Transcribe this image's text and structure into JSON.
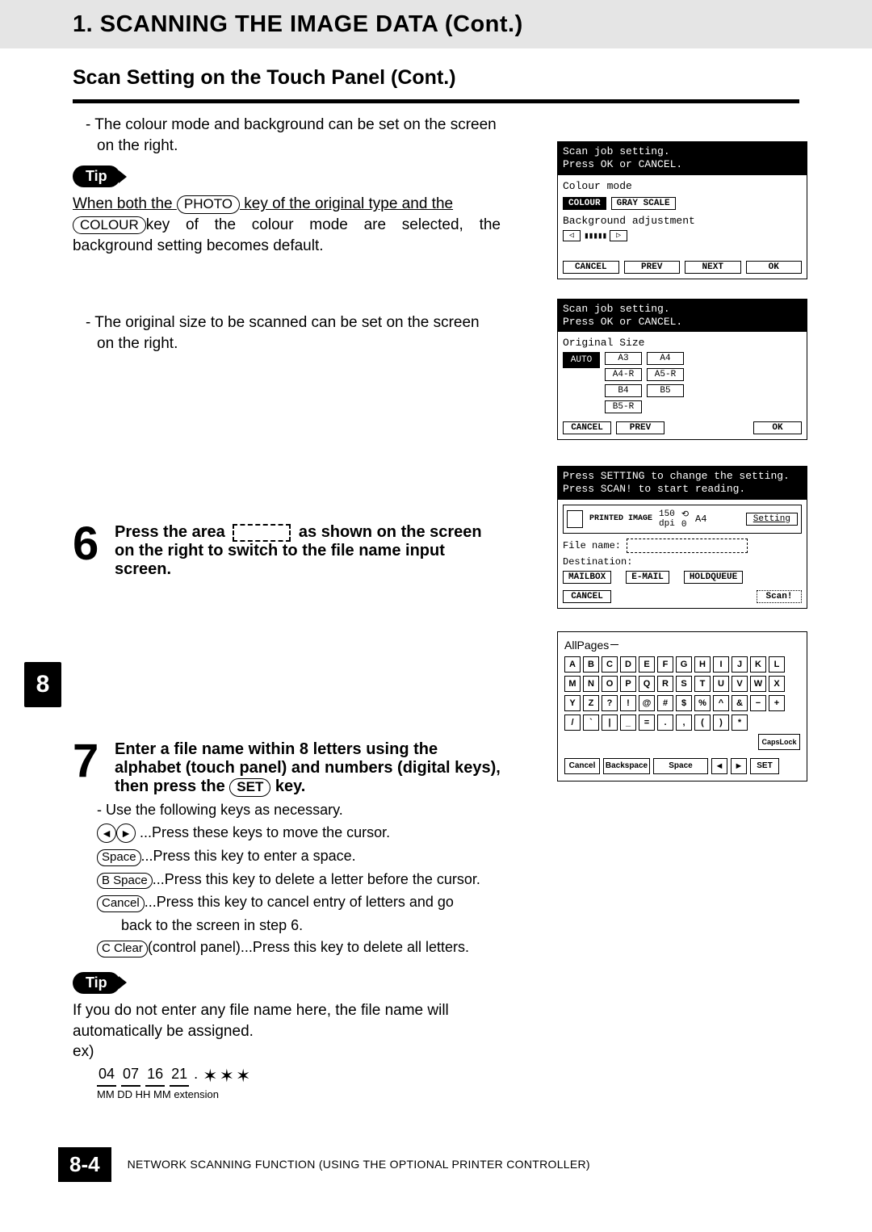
{
  "header": {
    "chapter": "1. SCANNING THE IMAGE DATA (Cont.)",
    "subsection": "Scan Setting on the Touch Panel (Cont.)"
  },
  "intro": {
    "p1": "The colour mode and background can be set on the screen on the right.",
    "tip_label": "Tip",
    "tip_body_1": "When both the ",
    "tip_key_photo": "PHOTO",
    "tip_body_2": " key of the original type and the ",
    "tip_key_colour": "COLOUR",
    "tip_body_3": "key of the colour mode are selected, the background setting becomes default.",
    "p2": "The original size to be scanned can be set on the screen on the right."
  },
  "screen1": {
    "head1": "Scan job setting.",
    "head2": "Press OK or CANCEL.",
    "colour_mode": "Colour mode",
    "btn_colour": "COLOUR",
    "btn_gray": "GRAY SCALE",
    "bg_adj": "Background adjustment",
    "cancel": "CANCEL",
    "prev": "PREV",
    "next": "NEXT",
    "ok": "OK"
  },
  "screen2": {
    "head1": "Scan job setting.",
    "head2": "Press OK or CANCEL.",
    "orig_size": "Original Size",
    "auto": "AUTO",
    "a3": "A3",
    "a4": "A4",
    "a4r": "A4-R",
    "a5r": "A5-R",
    "b4": "B4",
    "b5": "B5",
    "b5r": "B5-R",
    "cancel": "CANCEL",
    "prev": "PREV",
    "ok": "OK"
  },
  "step6": {
    "num": "6",
    "text_a": "Press the area ",
    "text_b": " as shown on the screen on the right to switch to the file name input screen."
  },
  "screen3": {
    "head1": "Press SETTING to change the setting.",
    "head2": "Press SCAN! to start reading.",
    "printed_image": "PRINTED IMAGE",
    "dpi_val": "150",
    "dpi_label": "dpi",
    "orient_val": "0",
    "size_val": "A4",
    "setting": "Setting",
    "file_name": "File name:",
    "destination": "Destination:",
    "mailbox": "MAILBOX",
    "email": "E-MAIL",
    "holdqueue": "HOLDQUEUE",
    "cancel": "CANCEL",
    "scan": "Scan!"
  },
  "step7": {
    "num": "7",
    "line1": "Enter a file name within 8 letters using the alphabet (touch panel) and numbers (digital keys), then press the ",
    "set_key": "SET",
    "line1b": " key.",
    "use_following": "Use the following keys as necessary.",
    "move_cursor": " ...Press these keys to move the cursor.",
    "space_key": "Space",
    "space_txt": "...Press this key to enter a space.",
    "bspace_key": "B Space",
    "bspace_txt": "...Press this key to delete a letter before the cursor.",
    "cancel_key": "Cancel",
    "cancel_txt": "...Press this key to cancel entry of letters and go",
    "cancel_txt2": "back to the screen in step 6.",
    "cclear_key": "C Clear",
    "cclear_txt": "(control panel)...Press this key to delete all letters."
  },
  "keyboard": {
    "header": "AllPages",
    "row1": [
      "A",
      "B",
      "C",
      "D",
      "E",
      "F",
      "G",
      "H",
      "I",
      "J",
      "K",
      "L"
    ],
    "row2": [
      "M",
      "N",
      "O",
      "P",
      "Q",
      "R",
      "S",
      "T",
      "U",
      "V",
      "W",
      "X"
    ],
    "row3": [
      "Y",
      "Z",
      "?",
      "!",
      "@",
      "#",
      "$",
      "%",
      "^",
      "&",
      "−",
      "+"
    ],
    "row4": [
      "/",
      "`",
      "|",
      "_",
      "=",
      ".",
      ",",
      "(",
      ")",
      "*"
    ],
    "capslock": "CapsLock",
    "cancel": "Cancel",
    "backspace": "Backspace",
    "space": "Space",
    "set": "SET"
  },
  "tip2": {
    "label": "Tip",
    "body": "If you do not enter any file name here, the file name will automatically be assigned.",
    "ex": "ex)",
    "d1": "04",
    "d2": "07",
    "d3": "16",
    "d4": "21",
    "dot": ".",
    "stars": "✶✶✶",
    "labels": "MM  DD  HH  MM extension"
  },
  "page_tab": "8",
  "footer": {
    "page": "8-4",
    "text": "NETWORK SCANNING FUNCTION (USING THE OPTIONAL PRINTER CONTROLLER)"
  }
}
